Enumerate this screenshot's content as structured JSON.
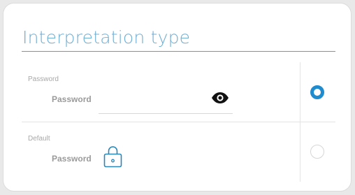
{
  "panel": {
    "title": "Interpretation type"
  },
  "options": [
    {
      "row_label": "Password",
      "field_label": "Password",
      "input_value": "",
      "icon": "eye-icon",
      "selected": true
    },
    {
      "row_label": "Default",
      "field_label": "Password",
      "icon": "lock-icon",
      "selected": false
    }
  ],
  "colors": {
    "accent": "#1f8ccf",
    "title": "#6faed3",
    "label": "#9a9a9a",
    "lock": "#2a87b8"
  }
}
